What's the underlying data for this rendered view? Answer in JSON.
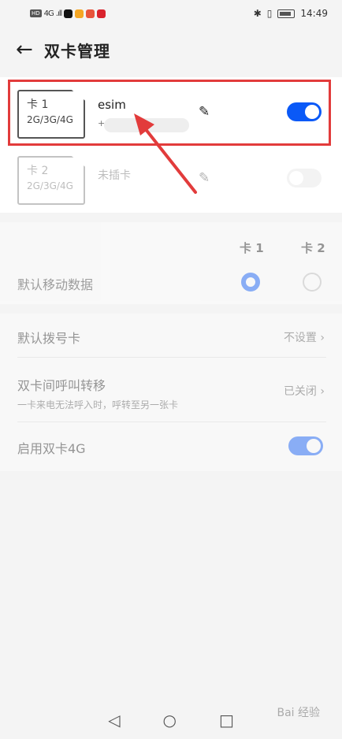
{
  "status_bar": {
    "left_badge": "HD",
    "net": "4G",
    "signal": ".ıll",
    "time": "14:49"
  },
  "header": {
    "back_icon": "back-arrow-icon",
    "title": "双卡管理"
  },
  "sims": [
    {
      "card_label": "卡 1",
      "card_types": "2G/3G/4G",
      "name": "esim",
      "number": "+",
      "enabled": true
    },
    {
      "card_label": "卡 2",
      "card_types": "2G/3G/4G",
      "name": "未插卡",
      "enabled": false
    }
  ],
  "data_section": {
    "col1": "卡 1",
    "col2": "卡 2",
    "label": "默认移动数据",
    "selected": "卡 1"
  },
  "settings": {
    "dial": {
      "label": "默认拨号卡",
      "value": "不设置"
    },
    "forward": {
      "label": "双卡间呼叫转移",
      "sub": "一卡来电无法呼入时，呼转至另一张卡",
      "value": "已关闭"
    },
    "dual4g": {
      "label": "启用双卡4G",
      "enabled": true
    }
  },
  "colors": {
    "accent": "#0a59f7",
    "highlight": "#e23b3b"
  },
  "watermark": "Bai 经验"
}
